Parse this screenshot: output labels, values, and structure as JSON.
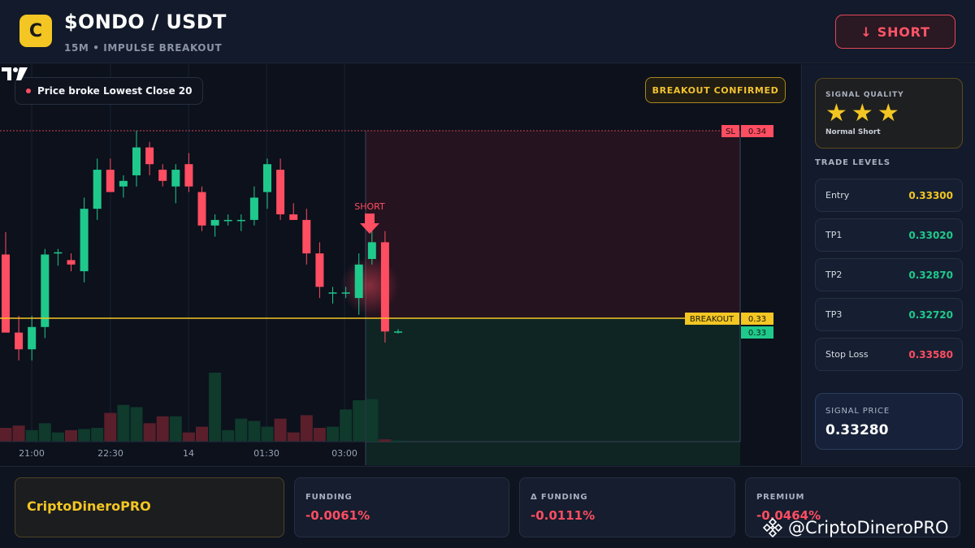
{
  "header": {
    "logo_letter": "C",
    "title": "$ONDO / USDT",
    "subtitle": "15M • IMPULSE BREAKOUT",
    "short_button": "↓ SHORT"
  },
  "chart": {
    "legend_text": "Price broke Lowest Close 20",
    "breakout_badge": "BREAKOUT CONFIRMED",
    "short_marker": "SHORT",
    "sl_tag": "SL",
    "sl_value": "0.34",
    "breakout_tag": "BREAKOUT",
    "breakout_value": "0.33",
    "last_price_value": "0.33",
    "time_labels": [
      "21:00",
      "22:30",
      "14",
      "01:30",
      "03:00"
    ]
  },
  "chart_data": {
    "type": "candlestick",
    "x": [
      "21:00",
      "22:30",
      "14",
      "01:30",
      "03:00"
    ],
    "candles": [
      {
        "o": 0.33335,
        "h": 0.33355,
        "l": 0.33265,
        "c": 0.33265,
        "dir": "down"
      },
      {
        "o": 0.33265,
        "h": 0.3328,
        "l": 0.3324,
        "c": 0.3325,
        "dir": "down"
      },
      {
        "o": 0.3325,
        "h": 0.3328,
        "l": 0.3324,
        "c": 0.3327,
        "dir": "up"
      },
      {
        "o": 0.3327,
        "h": 0.3334,
        "l": 0.3326,
        "c": 0.33335,
        "dir": "up"
      },
      {
        "o": 0.33337,
        "h": 0.3334,
        "l": 0.33325,
        "c": 0.33337,
        "dir": "doji"
      },
      {
        "o": 0.3333,
        "h": 0.33336,
        "l": 0.3332,
        "c": 0.33326,
        "dir": "down"
      },
      {
        "o": 0.3332,
        "h": 0.33386,
        "l": 0.3331,
        "c": 0.33376,
        "dir": "up"
      },
      {
        "o": 0.33376,
        "h": 0.33421,
        "l": 0.33366,
        "c": 0.33411,
        "dir": "up"
      },
      {
        "o": 0.33411,
        "h": 0.33421,
        "l": 0.33391,
        "c": 0.33391,
        "dir": "down"
      },
      {
        "o": 0.33396,
        "h": 0.33406,
        "l": 0.33386,
        "c": 0.33401,
        "dir": "up"
      },
      {
        "o": 0.33406,
        "h": 0.33446,
        "l": 0.33396,
        "c": 0.33431,
        "dir": "up"
      },
      {
        "o": 0.33431,
        "h": 0.33436,
        "l": 0.33406,
        "c": 0.33416,
        "dir": "down"
      },
      {
        "o": 0.33411,
        "h": 0.33416,
        "l": 0.33396,
        "c": 0.33401,
        "dir": "down"
      },
      {
        "o": 0.33396,
        "h": 0.33416,
        "l": 0.33381,
        "c": 0.33411,
        "dir": "up"
      },
      {
        "o": 0.33416,
        "h": 0.33426,
        "l": 0.33391,
        "c": 0.33396,
        "dir": "down"
      },
      {
        "o": 0.33391,
        "h": 0.33396,
        "l": 0.33356,
        "c": 0.33361,
        "dir": "down"
      },
      {
        "o": 0.33361,
        "h": 0.33371,
        "l": 0.33351,
        "c": 0.33366,
        "dir": "up"
      },
      {
        "o": 0.33366,
        "h": 0.33371,
        "l": 0.33361,
        "c": 0.33366,
        "dir": "doji"
      },
      {
        "o": 0.33366,
        "h": 0.33371,
        "l": 0.33356,
        "c": 0.33366,
        "dir": "doji"
      },
      {
        "o": 0.33366,
        "h": 0.33396,
        "l": 0.33361,
        "c": 0.33386,
        "dir": "up"
      },
      {
        "o": 0.33391,
        "h": 0.33421,
        "l": 0.33376,
        "c": 0.33416,
        "dir": "up"
      },
      {
        "o": 0.33411,
        "h": 0.33421,
        "l": 0.33366,
        "c": 0.33371,
        "dir": "down"
      },
      {
        "o": 0.33371,
        "h": 0.33381,
        "l": 0.33366,
        "c": 0.33366,
        "dir": "down"
      },
      {
        "o": 0.33366,
        "h": 0.33376,
        "l": 0.33326,
        "c": 0.33336,
        "dir": "down"
      },
      {
        "o": 0.33336,
        "h": 0.33346,
        "l": 0.33296,
        "c": 0.33306,
        "dir": "down"
      },
      {
        "o": 0.33301,
        "h": 0.33306,
        "l": 0.33291,
        "c": 0.33301,
        "dir": "doji"
      },
      {
        "o": 0.33301,
        "h": 0.33306,
        "l": 0.33296,
        "c": 0.33301,
        "dir": "doji"
      },
      {
        "o": 0.33296,
        "h": 0.33336,
        "l": 0.33281,
        "c": 0.33326,
        "dir": "up"
      },
      {
        "o": 0.33331,
        "h": 0.33356,
        "l": 0.33326,
        "c": 0.33346,
        "dir": "up"
      },
      {
        "o": 0.33346,
        "h": 0.33356,
        "l": 0.33256,
        "c": 0.33266,
        "dir": "down"
      },
      {
        "o": 0.33266,
        "h": 0.33268,
        "l": 0.33264,
        "c": 0.33266,
        "dir": "doji"
      }
    ],
    "volumes": [
      12,
      14,
      10,
      16,
      8,
      10,
      11,
      12,
      25,
      32,
      30,
      16,
      22,
      22,
      8,
      13,
      60,
      10,
      20,
      18,
      13,
      20,
      8,
      23,
      12,
      13,
      28,
      36,
      37,
      2,
      1
    ],
    "levels": {
      "sl": 0.34,
      "breakout": 0.33,
      "last": 0.33
    }
  },
  "panel": {
    "quality_title": "SIGNAL QUALITY",
    "quality_label": "Normal Short",
    "stars": 3,
    "levels_title": "TRADE LEVELS",
    "levels": [
      {
        "name": "Entry",
        "value": "0.33300",
        "color": "#f3c623"
      },
      {
        "name": "TP1",
        "value": "0.33020",
        "color": "#1fc98c"
      },
      {
        "name": "TP2",
        "value": "0.32870",
        "color": "#1fc98c"
      },
      {
        "name": "TP3",
        "value": "0.32720",
        "color": "#1fc98c"
      },
      {
        "name": "Stop Loss",
        "value": "0.33580",
        "color": "#ff4d61"
      }
    ],
    "signal_title": "SIGNAL PRICE",
    "signal_value": "0.33280"
  },
  "footer": {
    "brand": "CriptoDineroPRO",
    "stats": [
      {
        "label": "FUNDING",
        "value": "-0.0061%"
      },
      {
        "label": "Δ FUNDING",
        "value": "-0.0111%"
      },
      {
        "label": "PREMIUM",
        "value": "-0.0464%"
      }
    ],
    "watermark": "@CriptoDineroPRO"
  },
  "colors": {
    "up": "#1fc98c",
    "down": "#ff4d61",
    "accent": "#f3c623"
  }
}
